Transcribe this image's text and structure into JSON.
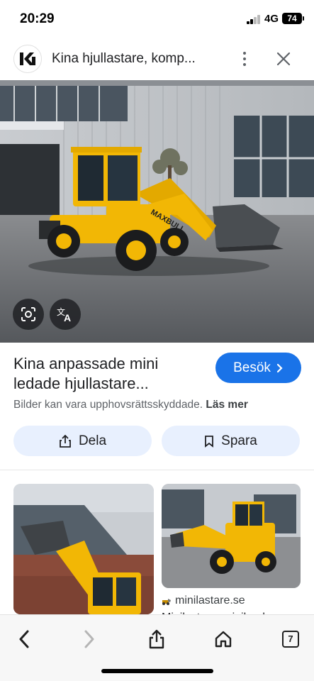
{
  "status": {
    "time": "20:29",
    "network": "4G",
    "battery": "74"
  },
  "header": {
    "logo_text": "KI",
    "title": "Kina hjullastare, komp..."
  },
  "image": {
    "loader_brand_text": "MAXBULL"
  },
  "result": {
    "title": "Kina anpassade mini ledade hjullastare...",
    "visit_label": "Besök",
    "copyright_text": "Bilder kan vara upphovsrättsskyddade.",
    "learn_more": "Läs mer"
  },
  "actions": {
    "share_label": "Dela",
    "save_label": "Spara"
  },
  "related": [
    {
      "source": ""
    },
    {
      "source": "minilastare.se",
      "caption": "Minilastare, miniloader..."
    }
  ],
  "bottom_nav": {
    "tabs_count": "7"
  },
  "colors": {
    "accent": "#1a73e8",
    "action_bg": "#e8f0fe",
    "loader_yellow": "#f2b705"
  },
  "icons": [
    "google-lens-icon",
    "translate-icon",
    "chevron-right-icon",
    "share-icon",
    "bookmark-icon",
    "back-icon",
    "forward-icon",
    "home-icon",
    "tabs-icon"
  ]
}
